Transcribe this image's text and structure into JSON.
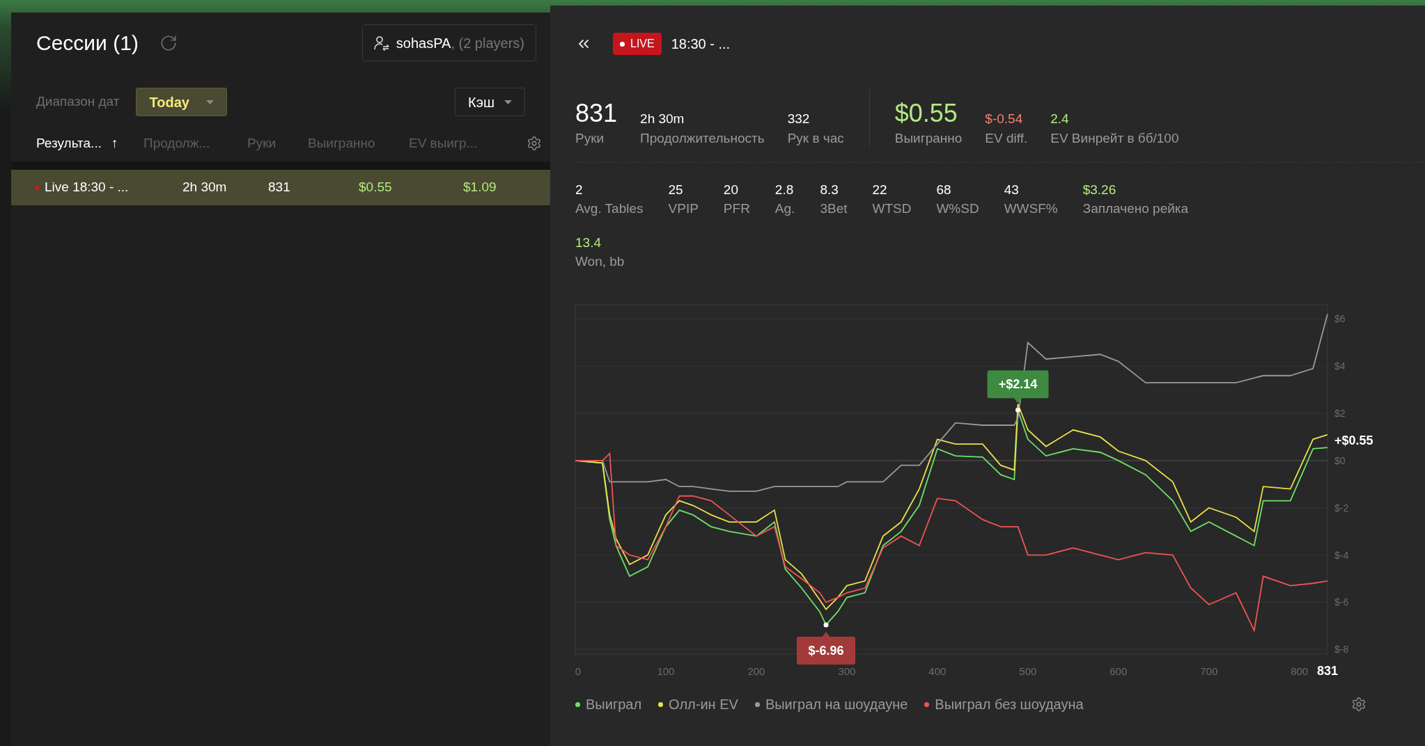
{
  "sessions_panel": {
    "title": "Сессии (1)",
    "player_button": {
      "name": "sohasPA",
      "suffix": ", (2 players)"
    },
    "date_range": {
      "label": "Диапазон дат",
      "value": "Today"
    },
    "game_type": "Кэш",
    "columns": [
      {
        "label": "Результа...",
        "sorted": true,
        "sort_indicator": "↑"
      },
      {
        "label": "Продолж...",
        "sorted": false
      },
      {
        "label": "Руки",
        "sorted": false
      },
      {
        "label": "Выигранно",
        "sorted": false
      },
      {
        "label": "EV выигр...",
        "sorted": false
      }
    ],
    "rows": [
      {
        "live": true,
        "name": "Live 18:30 - ...",
        "duration": "2h 30m",
        "hands": "831",
        "won": "$0.55",
        "ev_won": "$1.09",
        "selected": true
      }
    ]
  },
  "session_detail": {
    "live_badge": "LIVE",
    "title": "18:30 - ...",
    "hands_summary": [
      {
        "value": "831",
        "label": "Руки",
        "kind": "large",
        "color": "#ffffff"
      },
      {
        "value": "2h 30m",
        "label": "Продолжительность",
        "kind": "normal",
        "color": "#ffffff"
      },
      {
        "value": "332",
        "label": "Рук в час",
        "kind": "normal",
        "color": "#ffffff"
      }
    ],
    "money_summary": [
      {
        "value": "$0.55",
        "label": "Выигранно",
        "kind": "large",
        "color": "#b2ea7e"
      },
      {
        "value": "$-0.54",
        "label": "EV diff.",
        "kind": "normal",
        "color": "#f0826e"
      },
      {
        "value": "2.4",
        "label": "EV Винрейт в бб/100",
        "kind": "normal",
        "color": "#b2ea7e"
      }
    ],
    "stats_rows": [
      [
        {
          "value": "2",
          "label": "Avg. Tables",
          "color": "#ffffff"
        },
        {
          "value": "25",
          "label": "VPIP",
          "color": "#ffffff"
        },
        {
          "value": "20",
          "label": "PFR",
          "color": "#ffffff"
        },
        {
          "value": "2.8",
          "label": "Ag.",
          "color": "#ffffff"
        },
        {
          "value": "8.3",
          "label": "3Bet",
          "color": "#ffffff"
        },
        {
          "value": "22",
          "label": "WTSD",
          "color": "#ffffff"
        },
        {
          "value": "68",
          "label": "W%SD",
          "color": "#ffffff"
        },
        {
          "value": "43",
          "label": "WWSF%",
          "color": "#ffffff"
        },
        {
          "value": "$3.26",
          "label": "Заплачено рейка",
          "color": "#b2ea7e"
        }
      ],
      [
        {
          "value": "13.4",
          "label": "Won, bb",
          "color": "#b2ea7e"
        }
      ]
    ],
    "chart_data": {
      "type": "line",
      "grid": true,
      "x": [
        0,
        30,
        38,
        45,
        60,
        80,
        100,
        115,
        130,
        150,
        170,
        200,
        220,
        232,
        250,
        270,
        277,
        290,
        300,
        320,
        340,
        360,
        380,
        400,
        420,
        450,
        470,
        485,
        489,
        500,
        520,
        550,
        580,
        600,
        630,
        660,
        680,
        700,
        730,
        750,
        760,
        790,
        815,
        831
      ],
      "series": [
        {
          "name": "Выиграл",
          "color": "#6ee26a",
          "values": [
            0,
            -0.1,
            -2.5,
            -3.6,
            -4.9,
            -4.5,
            -2.8,
            -2.1,
            -2.3,
            -2.8,
            -3.0,
            -3.2,
            -2.6,
            -4.6,
            -5.4,
            -6.4,
            -6.96,
            -6.4,
            -5.8,
            -5.6,
            -3.6,
            -3.0,
            -1.9,
            0.5,
            0.2,
            0.15,
            -0.6,
            -0.8,
            2.14,
            0.9,
            0.2,
            0.5,
            0.35,
            0.0,
            -0.6,
            -1.7,
            -3.0,
            -2.6,
            -3.2,
            -3.6,
            -1.7,
            -1.7,
            0.5,
            0.55
          ]
        },
        {
          "name": "Олл-ин EV",
          "color": "#e8e24a",
          "values": [
            0,
            -0.1,
            -2.3,
            -3.3,
            -4.4,
            -4.0,
            -2.3,
            -1.7,
            -1.9,
            -2.3,
            -2.6,
            -2.6,
            -2.1,
            -4.2,
            -4.8,
            -5.9,
            -6.3,
            -5.8,
            -5.3,
            -5.1,
            -3.2,
            -2.6,
            -1.2,
            0.9,
            0.7,
            0.7,
            -0.2,
            -0.4,
            2.4,
            1.3,
            0.6,
            1.3,
            1.0,
            0.4,
            0.0,
            -0.9,
            -2.6,
            -2.0,
            -2.4,
            -3.0,
            -1.1,
            -1.2,
            0.9,
            1.1
          ]
        },
        {
          "name": "Выиграл на шоудауне",
          "color": "#9a9a9a",
          "values": [
            0,
            0,
            -0.9,
            -0.9,
            -0.9,
            -0.9,
            -0.8,
            -1.1,
            -1.1,
            -1.2,
            -1.3,
            -1.3,
            -1.1,
            -1.1,
            -1.1,
            -1.1,
            -1.1,
            -1.1,
            -0.9,
            -0.9,
            -0.9,
            -0.2,
            -0.2,
            0.7,
            1.6,
            1.5,
            1.5,
            1.5,
            1.8,
            5.0,
            4.3,
            4.4,
            4.5,
            4.2,
            3.3,
            3.3,
            3.3,
            3.3,
            3.3,
            3.5,
            3.6,
            3.6,
            3.9,
            6.2
          ]
        },
        {
          "name": "Выиграл без шоудауна",
          "color": "#f05454",
          "values": [
            0,
            0,
            0.3,
            -3.6,
            -4.0,
            -4.2,
            -2.8,
            -1.5,
            -1.5,
            -1.7,
            -2.3,
            -3.2,
            -2.8,
            -4.5,
            -5.0,
            -5.6,
            -6.0,
            -5.8,
            -5.6,
            -5.4,
            -3.7,
            -3.2,
            -3.6,
            -1.6,
            -1.7,
            -2.5,
            -2.8,
            -2.8,
            -2.8,
            -4.0,
            -4.0,
            -3.7,
            -4.0,
            -4.2,
            -3.9,
            -4.0,
            -5.4,
            -6.1,
            -5.6,
            -7.2,
            -4.9,
            -5.3,
            -5.2,
            -5.1
          ]
        }
      ],
      "xlim": [
        0,
        831
      ],
      "ylim": [
        -8.2,
        6.6
      ],
      "xticks": [
        0,
        100,
        200,
        300,
        400,
        500,
        600,
        700,
        800,
        {
          "value": 831,
          "label": "831"
        }
      ],
      "yticks": [
        {
          "value": 6,
          "label": "$6"
        },
        {
          "value": 4,
          "label": "$4"
        },
        {
          "value": 2,
          "label": "$2"
        },
        {
          "value": 0,
          "label": "$0"
        },
        {
          "value": -2,
          "label": "$-2"
        },
        {
          "value": -4,
          "label": "$-4"
        },
        {
          "value": -6,
          "label": "$-6"
        },
        {
          "value": -8,
          "label": "$-8"
        }
      ],
      "annotations": [
        {
          "x": 489,
          "y": 2.14,
          "text": "+$2.14"
        },
        {
          "x": 277,
          "y": -6.96,
          "text": "$-6.96"
        },
        {
          "x": 831,
          "y": 0.55,
          "text": "+$0.55"
        }
      ]
    }
  }
}
